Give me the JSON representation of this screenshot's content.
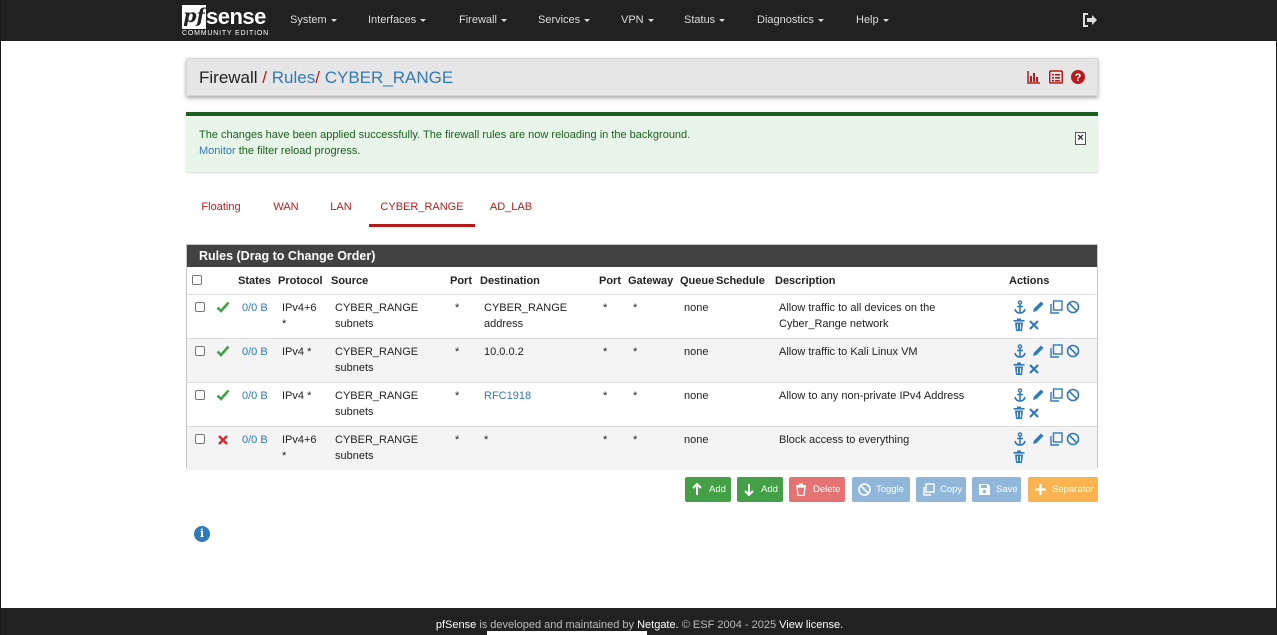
{
  "nav": {
    "logo_pf": "pf",
    "logo_sense": "sense",
    "logo_edition": "COMMUNITY EDITION",
    "menus": [
      "System",
      "Interfaces",
      "Firewall",
      "Services",
      "VPN",
      "Status",
      "Diagnostics",
      "Help"
    ]
  },
  "breadcrumb": {
    "root": "Firewall",
    "sep": "/",
    "rules": "Rules",
    "current": "CYBER_RANGE"
  },
  "alert": {
    "line1": "The changes have been applied successfully. The firewall rules are now reloading in the background.",
    "link": "Monitor",
    "line2_rest": " the filter reload progress.",
    "close": "×"
  },
  "tabs": [
    "Floating",
    "WAN",
    "LAN",
    "CYBER_RANGE",
    "AD_LAB"
  ],
  "active_tab": "CYBER_RANGE",
  "panel_title": "Rules (Drag to Change Order)",
  "columns": [
    "States",
    "Protocol",
    "Source",
    "Port",
    "Destination",
    "Port",
    "Gateway",
    "Queue",
    "Schedule",
    "Description",
    "Actions"
  ],
  "rules": [
    {
      "status": "pass",
      "states": "0/0 B",
      "protocol1": "IPv4+6",
      "protocol2": "*",
      "source1": "CYBER_RANGE",
      "source2": "subnets",
      "sport": "*",
      "dest1": "CYBER_RANGE",
      "dest2": "address",
      "dest_link": false,
      "dport": "*",
      "gateway": "*",
      "queue": "none",
      "schedule": "",
      "desc1": "Allow traffic to all devices on the",
      "desc2": "Cyber_Range network"
    },
    {
      "status": "pass",
      "states": "0/0 B",
      "protocol1": "IPv4 *",
      "protocol2": "",
      "source1": "CYBER_RANGE",
      "source2": "subnets",
      "sport": "*",
      "dest1": "10.0.0.2",
      "dest2": "",
      "dest_link": false,
      "dport": "*",
      "gateway": "*",
      "queue": "none",
      "schedule": "",
      "desc1": "Allow traffic to Kali Linux VM",
      "desc2": ""
    },
    {
      "status": "pass",
      "states": "0/0 B",
      "protocol1": "IPv4 *",
      "protocol2": "",
      "source1": "CYBER_RANGE",
      "source2": "subnets",
      "sport": "*",
      "dest1": "RFC1918",
      "dest2": "",
      "dest_link": true,
      "dport": "*",
      "gateway": "*",
      "queue": "none",
      "schedule": "",
      "desc1": "Allow to any non-private IPv4 Address",
      "desc2": ""
    },
    {
      "status": "block",
      "states": "0/0 B",
      "protocol1": "IPv4+6",
      "protocol2": "*",
      "source1": "CYBER_RANGE",
      "source2": "subnets",
      "sport": "*",
      "dest1": "*",
      "dest2": "",
      "dest_link": false,
      "dport": "*",
      "gateway": "*",
      "queue": "none",
      "schedule": "",
      "desc1": "Block access to everything",
      "desc2": ""
    }
  ],
  "buttons": {
    "add_top": "Add",
    "add_bottom": "Add",
    "delete": "Delete",
    "toggle": "Toggle",
    "copy": "Copy",
    "save": "Save",
    "separator": "Separator"
  },
  "footer": {
    "brand": "pfSense",
    "text1": " is developed and maintained by ",
    "company": "Netgate.",
    "text2": " © ESF 2004 - 2025 ",
    "license": "View license."
  },
  "colors": {
    "navbar": "#212121",
    "brand_red": "#b71c1c",
    "link_blue": "#317ab8",
    "pass_green": "#43a047",
    "block_red": "#d32f2f",
    "btn_green": "#43a047",
    "btn_red": "#e57373",
    "btn_blue": "#90b6d9",
    "btn_orange": "#f9b451"
  },
  "icons": [
    "anchor-icon",
    "pencil-icon",
    "copy-icon",
    "ban-icon",
    "trash-icon",
    "x-icon",
    "check-icon",
    "info-icon",
    "sign-out-icon",
    "bar-chart-icon",
    "list-icon",
    "help-icon"
  ]
}
